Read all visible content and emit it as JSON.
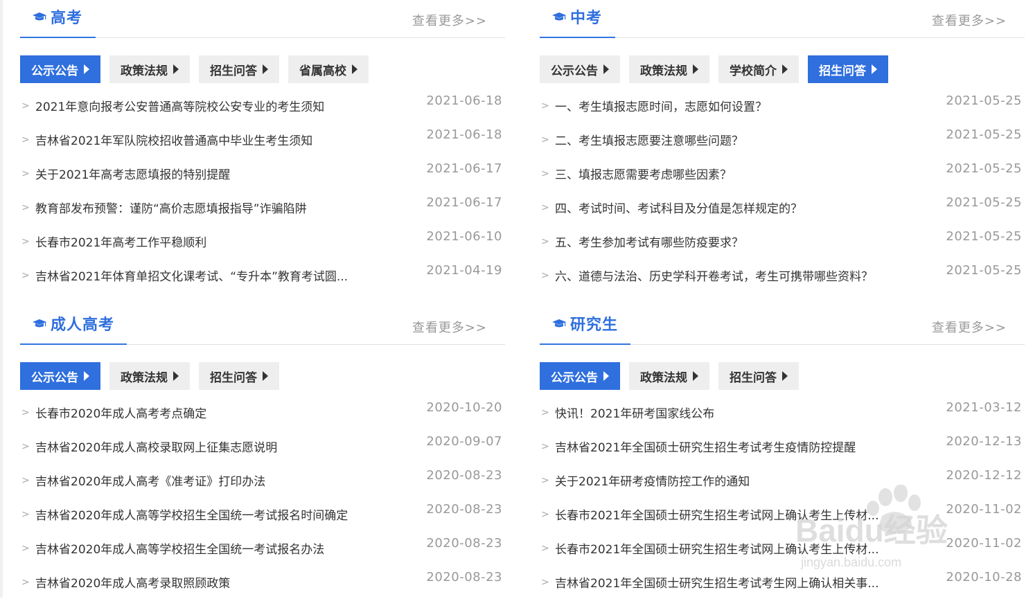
{
  "panels": [
    {
      "title": "高考",
      "more": "查看更多>>",
      "tabs": [
        {
          "label": "公示公告",
          "active": true
        },
        {
          "label": "政策法规",
          "active": false
        },
        {
          "label": "招生问答",
          "active": false
        },
        {
          "label": "省属高校",
          "active": false
        }
      ],
      "items": [
        {
          "title": "2021年意向报考公安普通高等院校公安专业的考生须知",
          "date": "2021-06-18"
        },
        {
          "title": "吉林省2021年军队院校招收普通高中毕业生考生须知",
          "date": "2021-06-18"
        },
        {
          "title": "关于2021年高考志愿填报的特别提醒",
          "date": "2021-06-17"
        },
        {
          "title": "教育部发布预警：谨防“高价志愿填报指导”诈骗陷阱",
          "date": "2021-06-17"
        },
        {
          "title": "长春市2021年高考工作平稳顺利",
          "date": "2021-06-10"
        },
        {
          "title": "吉林省2021年体育单招文化课考试、“专升本”教育考试圆...",
          "date": "2021-04-19"
        }
      ]
    },
    {
      "title": "中考",
      "more": "查看更多>>",
      "tabs": [
        {
          "label": "公示公告",
          "active": false
        },
        {
          "label": "政策法规",
          "active": false
        },
        {
          "label": "学校简介",
          "active": false
        },
        {
          "label": "招生问答",
          "active": true
        }
      ],
      "items": [
        {
          "title": "一、考生填报志愿时间，志愿如何设置？",
          "date": "2021-05-25"
        },
        {
          "title": "二、考生填报志愿要注意哪些问题？",
          "date": "2021-05-25"
        },
        {
          "title": "三、填报志愿需要考虑哪些因素？",
          "date": "2021-05-25"
        },
        {
          "title": "四、考试时间、考试科目及分值是怎样规定的？",
          "date": "2021-05-25"
        },
        {
          "title": "五、考生参加考试有哪些防疫要求？",
          "date": "2021-05-25"
        },
        {
          "title": "六、道德与法治、历史学科开卷考试，考生可携带哪些资料？",
          "date": "2021-05-25"
        }
      ]
    },
    {
      "title": "成人高考",
      "more": "查看更多>>",
      "tabs": [
        {
          "label": "公示公告",
          "active": true
        },
        {
          "label": "政策法规",
          "active": false
        },
        {
          "label": "招生问答",
          "active": false
        }
      ],
      "items": [
        {
          "title": "长春市2020年成人高考考点确定",
          "date": "2020-10-20"
        },
        {
          "title": "吉林省2020年成人高校录取网上征集志愿说明",
          "date": "2020-09-07"
        },
        {
          "title": "吉林省2020年成人高考《准考证》打印办法",
          "date": "2020-08-23"
        },
        {
          "title": "吉林省2020年成人高等学校招生全国统一考试报名时间确定",
          "date": "2020-08-23"
        },
        {
          "title": "吉林省2020年成人高等学校招生全国统一考试报名办法",
          "date": "2020-08-23"
        },
        {
          "title": "吉林省2020年成人高考录取照顾政策",
          "date": "2020-08-23"
        }
      ]
    },
    {
      "title": "研究生",
      "more": "查看更多>>",
      "tabs": [
        {
          "label": "公示公告",
          "active": true
        },
        {
          "label": "政策法规",
          "active": false
        },
        {
          "label": "招生问答",
          "active": false
        }
      ],
      "items": [
        {
          "title": "快讯！2021年研考国家线公布",
          "date": "2021-03-12"
        },
        {
          "title": "吉林省2021年全国硕士研究生招生考试考生疫情防控提醒",
          "date": "2020-12-13"
        },
        {
          "title": "关于2021年研考疫情防控工作的通知",
          "date": "2020-12-12"
        },
        {
          "title": "长春市2021年全国硕士研究生招生考试网上确认考生上传材...",
          "date": "2020-11-02"
        },
        {
          "title": "长春市2021年全国硕士研究生招生考试网上确认考生上传材...",
          "date": "2020-11-02"
        },
        {
          "title": "吉林省2021年全国硕士研究生招生考试考生网上确认相关事...",
          "date": "2020-10-28"
        }
      ]
    }
  ],
  "watermark": {
    "brand": "Baidu经验",
    "url": "jingyan.baidu.com"
  },
  "colors": {
    "accent": "#2f6fde",
    "tab_bg": "#eeeeee",
    "date": "#999999",
    "more": "#9a9a9a"
  },
  "icons": {
    "title_icon": "graduation-cap-icon",
    "tab_arrow": "triangle-right-icon",
    "item_bullet": "chevron-right-icon"
  }
}
